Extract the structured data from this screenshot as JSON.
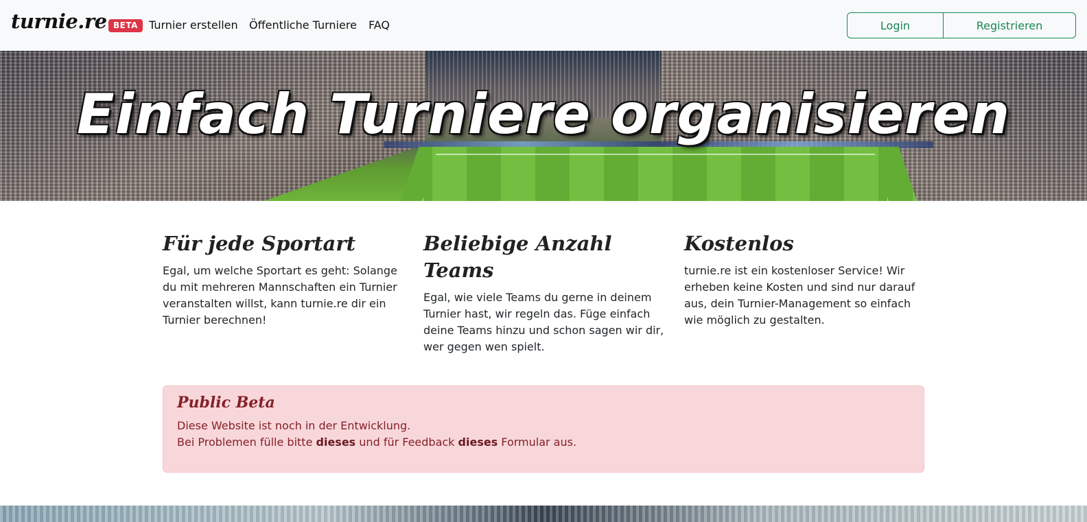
{
  "navbar": {
    "brand": "turnie.re",
    "badge": "BETA",
    "links": [
      "Turnier erstellen",
      "Öffentliche Turniere",
      "FAQ"
    ],
    "login": "Login",
    "register": "Registrieren"
  },
  "hero": {
    "title": "Einfach Turniere organisieren"
  },
  "features": [
    {
      "title": "Für jede Sportart",
      "text": "Egal, um welche Sportart es geht: Solange du mit mehreren Mannschaften ein Turnier veranstalten willst, kann turnie.re dir ein Turnier berechnen!"
    },
    {
      "title": "Beliebige Anzahl Teams",
      "text": "Egal, wie viele Teams du gerne in deinem Turnier hast, wir regeln das. Füge einfach deine Teams hinzu und schon sagen wir dir, wer gegen wen spielt."
    },
    {
      "title": "Kostenlos",
      "text": "turnie.re ist ein kostenloser Service! Wir erheben keine Kosten und sind nur darauf aus, dein Turnier-Management so einfach wie möglich zu gestalten."
    }
  ],
  "alert": {
    "title": "Public Beta",
    "line1": "Diese Website ist noch in der Entwicklung.",
    "line2_prefix": "Bei Problemen fülle bitte ",
    "link1": "dieses",
    "line2_middle": " und für Feedback ",
    "link2": "dieses",
    "line2_suffix": " Formular aus."
  },
  "colors": {
    "brand_badge": "#dc3545",
    "auth_accent": "#198754",
    "alert_bg": "#f8d7da",
    "alert_text": "#842029"
  }
}
